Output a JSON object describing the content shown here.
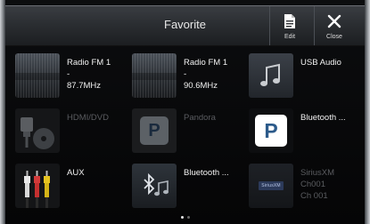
{
  "header": {
    "title": "Favorite",
    "edit_label": "Edit",
    "close_label": "Close"
  },
  "tiles": [
    {
      "lines": [
        "Radio FM 1",
        "-",
        "87.7MHz"
      ],
      "icon": "radio-tuner-thumbnail",
      "enabled": true
    },
    {
      "lines": [
        "Radio FM 1",
        "-",
        "90.6MHz"
      ],
      "icon": "radio-tuner-thumbnail",
      "enabled": true
    },
    {
      "lines": [
        "USB Audio"
      ],
      "icon": "music-note-icon",
      "enabled": true
    },
    {
      "lines": [
        "HDMI/DVD"
      ],
      "icon": "hdmi-disc-icon",
      "enabled": false
    },
    {
      "lines": [
        "Pandora"
      ],
      "icon": "pandora-icon",
      "enabled": false
    },
    {
      "lines": [
        "Bluetooth ..."
      ],
      "icon": "pandora-icon",
      "enabled": true
    },
    {
      "lines": [
        "AUX"
      ],
      "icon": "rca-cable-icon",
      "enabled": true
    },
    {
      "lines": [
        "Bluetooth ..."
      ],
      "icon": "bluetooth-music-icon",
      "enabled": true
    },
    {
      "lines": [
        "SiriusXM",
        "Ch001",
        "Ch 001"
      ],
      "icon": "siriusxm-logo",
      "logo_text": "SiriusXM",
      "enabled": false
    }
  ],
  "pager": {
    "pages": 2,
    "current": 1
  },
  "colors": {
    "accent": "#2b5a8a",
    "text": "#f2f2f2",
    "dim_text": "#5a5c60"
  }
}
